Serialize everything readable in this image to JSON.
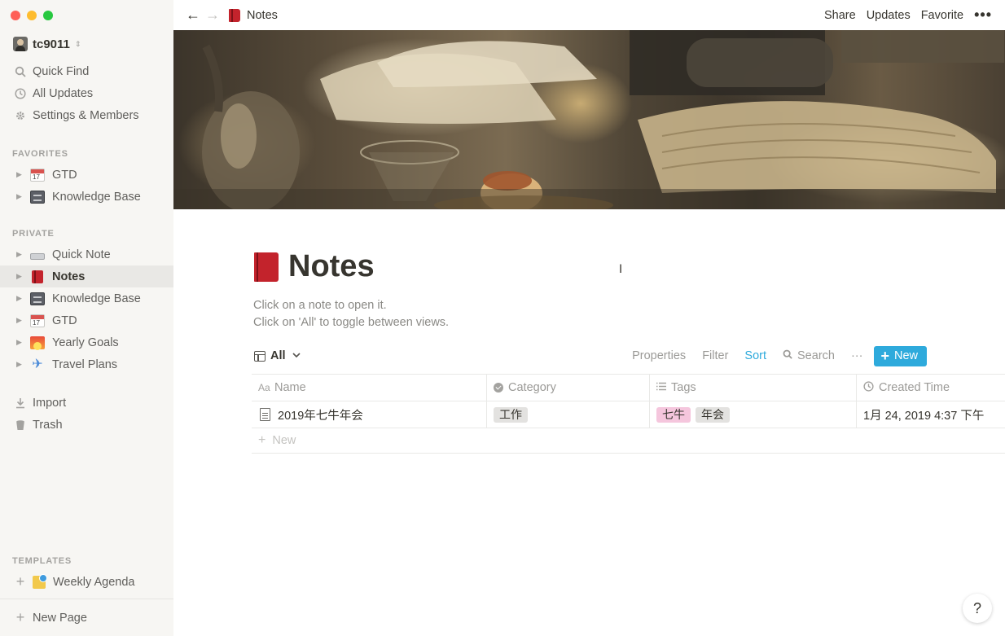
{
  "window": {
    "controls": [
      "close",
      "minimize",
      "zoom"
    ],
    "colors": {
      "close": "#fe5f57",
      "minimize": "#febc2e",
      "zoom": "#28c840"
    }
  },
  "sidebar": {
    "workspace": "tc9011",
    "top_items": [
      {
        "label": "Quick Find",
        "icon": "search-icon"
      },
      {
        "label": "All Updates",
        "icon": "clock-icon"
      },
      {
        "label": "Settings & Members",
        "icon": "gear-icon"
      }
    ],
    "favorites_label": "FAVORITES",
    "favorites": [
      {
        "label": "GTD",
        "icon": "calendar-emoji"
      },
      {
        "label": "Knowledge Base",
        "icon": "file-cabinet-emoji"
      }
    ],
    "private_label": "PRIVATE",
    "private": [
      {
        "label": "Quick Note",
        "icon": "keyboard-emoji"
      },
      {
        "label": "Notes",
        "icon": "red-book-emoji",
        "active": true
      },
      {
        "label": "Knowledge Base",
        "icon": "file-cabinet-emoji"
      },
      {
        "label": "GTD",
        "icon": "calendar-emoji"
      },
      {
        "label": "Yearly Goals",
        "icon": "sunrise-emoji"
      },
      {
        "label": "Travel Plans",
        "icon": "airplane-emoji"
      }
    ],
    "import_label": "Import",
    "trash_label": "Trash",
    "templates_label": "TEMPLATES",
    "template_item": "Weekly Agenda",
    "new_page_label": "New Page"
  },
  "topbar": {
    "breadcrumb": "Notes",
    "share": "Share",
    "updates": "Updates",
    "favorite": "Favorite",
    "more": "•••"
  },
  "page": {
    "title": "Notes",
    "description_1": "Click on a note to open it.",
    "description_2": "Click on 'All' to toggle between views."
  },
  "view": {
    "name": "All",
    "properties": "Properties",
    "filter": "Filter",
    "sort": "Sort",
    "search": "Search",
    "more": "···",
    "new": "New"
  },
  "table": {
    "columns": [
      {
        "label": "Name",
        "icon": "Aa"
      },
      {
        "label": "Category",
        "icon": "select-icon"
      },
      {
        "label": "Tags",
        "icon": "list-icon"
      },
      {
        "label": "Created Time",
        "icon": "clock-icon"
      }
    ],
    "rows": [
      {
        "name": "2019年七牛年会",
        "category": "工作",
        "tags": [
          "七牛",
          "年会"
        ],
        "created": "1月 24, 2019 4:37 下午"
      }
    ],
    "new_row_label": "New"
  },
  "help": "?",
  "colors": {
    "accent": "#2eaadc",
    "sidebar_bg": "#f7f6f3",
    "tag_pink": "#f5c6dd",
    "tag_gray": "#e3e2e0"
  }
}
